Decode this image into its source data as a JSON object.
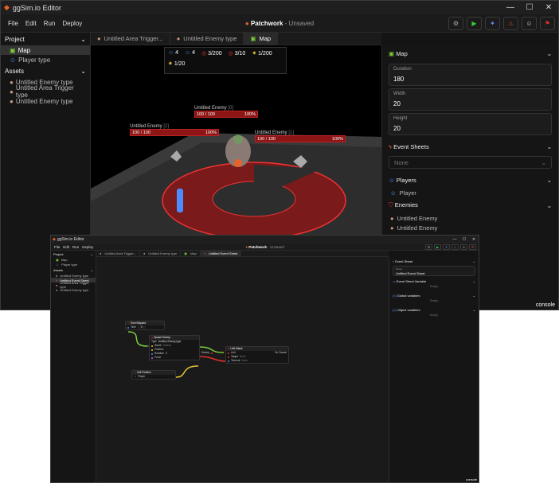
{
  "colors": {
    "accent": "#e8632b",
    "hp_red": "#8d1515",
    "link_green": "#7ccc3a",
    "link_yellow": "#e6c63a",
    "link_red": "#e03030",
    "link_gray": "#888888",
    "player_blue": "#4d8cff"
  },
  "main": {
    "title": "ggSim.io Editor",
    "window_controls": [
      "—",
      "☐",
      "✕"
    ],
    "menu": [
      "File",
      "Edit",
      "Run",
      "Deploy"
    ],
    "project": {
      "name": "Patchwork",
      "status": "- Unsaved"
    },
    "toolbar_icons": [
      "gear-icon",
      "play-icon",
      "magic-icon",
      "fire-icon",
      "user-icon",
      "flag-icon"
    ],
    "sidebar": {
      "project_header": "Project",
      "project_items": [
        "Map",
        "Player type"
      ],
      "assets_header": "Assets",
      "asset_items": [
        "Untitled Enemy type",
        "Untitled Area Trigger type",
        "Untitled Enemy type"
      ]
    },
    "tabs": [
      "Untitled Area Trigger...",
      "Untitled Enemy type",
      "Map"
    ],
    "hud": {
      "players_a": "4",
      "players_b": "4",
      "score1": "3/200",
      "score2": "3/10",
      "gold": "1/200",
      "special": "1/20"
    },
    "enemies": [
      {
        "name": "Untitled Enemy",
        "index": "[0]",
        "hp": "100 / 100",
        "pct": "100%"
      },
      {
        "name": "Untitled Enemy",
        "index": "[2]",
        "hp": "100 / 100",
        "pct": "100%"
      },
      {
        "name": "Untitled Enemy",
        "index": "[1]",
        "hp": "100 / 100",
        "pct": "100%"
      }
    ],
    "right_panel": {
      "map_header": "Map",
      "fields": [
        {
          "label": "Duration",
          "value": "180"
        },
        {
          "label": "Width",
          "value": "20"
        },
        {
          "label": "Height",
          "value": "20"
        }
      ],
      "event_sheets_header": "Event Sheets",
      "event_sheets_value": "None",
      "players_header": "Players",
      "players": [
        "Player"
      ],
      "enemies_header": "Enemies",
      "enemies": [
        "Untitled Enemy",
        "Untitled Enemy"
      ]
    },
    "console": "console"
  },
  "inset": {
    "title": "ggSim.io Editor",
    "menu": [
      "File",
      "Edit",
      "Run",
      "Deploy"
    ],
    "project": {
      "name": "Patchwork",
      "status": "- Unsaved"
    },
    "sidebar": {
      "project_header": "Project",
      "project_items": [
        "Map",
        "Player type"
      ],
      "assets_header": "Assets",
      "asset_items": [
        "Untitled Enemy type",
        "Untitled Event Sheet",
        "Untitled Area Trigger type",
        "Untitled Enemy type"
      ]
    },
    "tabs": [
      "Untitled Area Trigger...",
      "Untitled Enemy type",
      "Map",
      "Untitled Event Sheet"
    ],
    "nodes": {
      "time_elapsed": {
        "title": "Time Elapsed",
        "row": "Time",
        "value": "0"
      },
      "unit_position": {
        "title": "Unit Position",
        "row": "Player"
      },
      "spawn_enemy": {
        "title": "Spawn Enemy",
        "type_label": "Type",
        "type_value": "Untitled Enemy type",
        "name_label": "Name",
        "name_value": "Default",
        "position": "Position",
        "rotation_label": "Rotation",
        "rotation_value": "0",
        "force": "Force",
        "enemy_out": "Enemy"
      },
      "unit_attack": {
        "title": "Unit Attack",
        "unit": "Unit",
        "target": "Target",
        "target_value": "None",
        "timeout": "Timeout",
        "timeout_value": "None",
        "on_cancel": "On Cancel"
      }
    },
    "right_panel": {
      "event_sheet_header": "Event Sheet",
      "name_label": "Name",
      "name_value": "Untitled Event Sheet",
      "variable_header": "Event Sheet Variable",
      "empty1": "Empty",
      "global_header": "Global variables",
      "empty2": "Empty",
      "object_header": "Object variables",
      "empty3": "Empty"
    },
    "console": "console"
  }
}
